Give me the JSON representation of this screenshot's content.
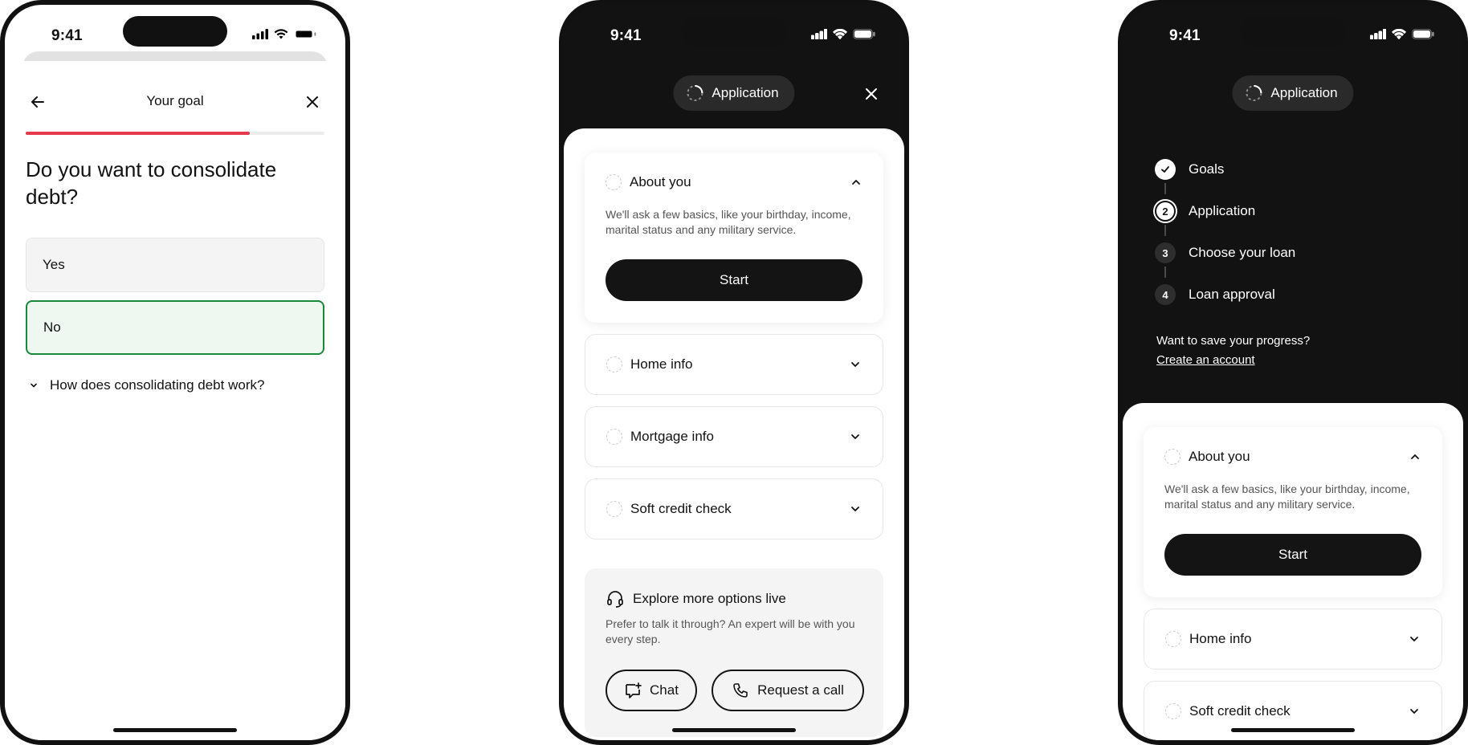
{
  "status": {
    "time": "9:41"
  },
  "screen1": {
    "title": "Your goal",
    "progress_fraction": 0.75,
    "question": "Do you want to consolidate debt?",
    "options": [
      {
        "label": "Yes",
        "selected": false
      },
      {
        "label": "No",
        "selected": true
      }
    ],
    "faq_label": "How does consolidating debt work?"
  },
  "screen2": {
    "pill_label": "Application",
    "sections": [
      {
        "title": "About you",
        "expanded": true,
        "description": "We'll ask a few basics, like your birthday, income, marital status and any military service.",
        "button": "Start"
      },
      {
        "title": "Home info",
        "expanded": false
      },
      {
        "title": "Mortgage info",
        "expanded": false
      },
      {
        "title": "Soft credit check",
        "expanded": false
      }
    ],
    "explore": {
      "title": "Explore more options live",
      "description": "Prefer to talk it through? An expert will be with you every step.",
      "chat_label": "Chat",
      "call_label": "Request a call"
    }
  },
  "screen3": {
    "pill_label": "Application",
    "steps": [
      {
        "number": "",
        "label": "Goals",
        "state": "done"
      },
      {
        "number": "2",
        "label": "Application",
        "state": "current"
      },
      {
        "number": "3",
        "label": "Choose your loan",
        "state": "upcoming"
      },
      {
        "number": "4",
        "label": "Loan approval",
        "state": "upcoming"
      }
    ],
    "save_prompt": "Want to save your progress?",
    "create_account": "Create an account",
    "sections": [
      {
        "title": "About you",
        "expanded": true,
        "description": "We'll ask a few basics, like your birthday, income, marital status and any military service.",
        "button": "Start"
      },
      {
        "title": "Home info",
        "expanded": false
      },
      {
        "title": "Soft credit check",
        "expanded": false
      }
    ]
  },
  "colors": {
    "progress": "#e5384a",
    "selected_border": "#178a3a",
    "selected_fill": "#eef7f0",
    "dark_bg": "#121212"
  }
}
